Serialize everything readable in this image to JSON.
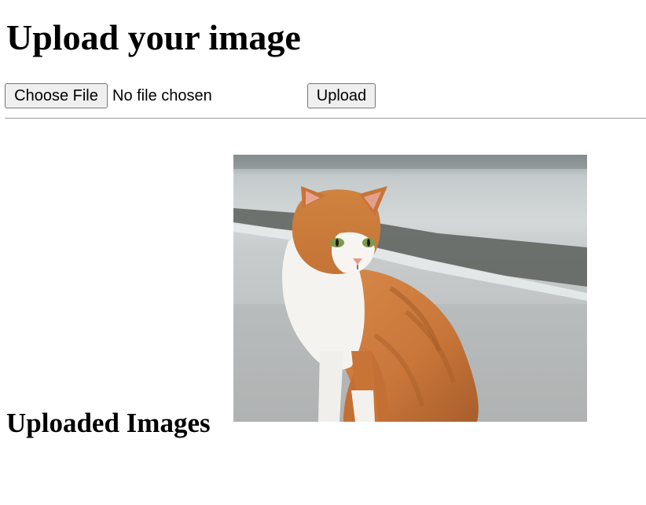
{
  "page": {
    "title": "Upload your image"
  },
  "upload_form": {
    "choose_file_label": "Choose File",
    "file_status": "No file chosen",
    "upload_label": "Upload"
  },
  "gallery": {
    "heading": "Uploaded Images",
    "images": [
      {
        "subject": "orange and white cat sitting on pavement"
      }
    ]
  },
  "colors": {
    "button_bg": "#efefef",
    "button_border": "#767676",
    "divider": "#9a9a9a"
  }
}
